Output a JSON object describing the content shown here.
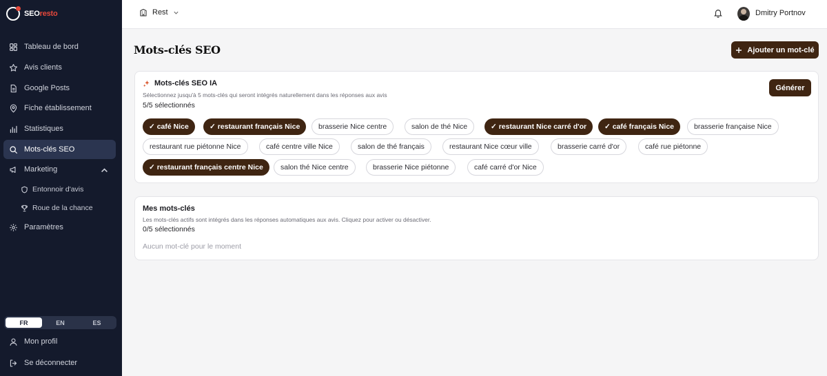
{
  "app": {
    "logo_main": "SEO",
    "logo_accent": "resto",
    "brand_color": "#3f2512",
    "logo_dot_color": "#e5483b"
  },
  "sidebar": {
    "items": [
      {
        "label": "Tableau de bord",
        "icon": "dashboard-icon"
      },
      {
        "label": "Avis clients",
        "icon": "star-icon"
      },
      {
        "label": "Google Posts",
        "icon": "document-icon"
      },
      {
        "label": "Fiche établissement",
        "icon": "map-pin-icon"
      },
      {
        "label": "Statistiques",
        "icon": "bar-chart-icon"
      },
      {
        "label": "Mots-clés SEO",
        "icon": "search-icon",
        "active": true
      },
      {
        "label": "Marketing",
        "icon": "megaphone-icon",
        "expanded": true
      }
    ],
    "sub_items": [
      {
        "label": "Entonnoir d'avis",
        "icon": "shield-icon"
      },
      {
        "label": "Roue de la chance",
        "icon": "trophy-icon"
      }
    ],
    "settings": {
      "label": "Paramètres",
      "icon": "gear-icon"
    },
    "languages": [
      "FR",
      "EN",
      "ES"
    ],
    "active_language": "FR",
    "profile": {
      "label": "Mon profil",
      "icon": "user-icon"
    },
    "logout": {
      "label": "Se déconnecter",
      "icon": "logout-icon"
    }
  },
  "header": {
    "restaurant": "Rest",
    "user_name": "Dmitry Portnov"
  },
  "page": {
    "title": "Mots-clés SEO",
    "add_button": "Ajouter un mot-clé"
  },
  "ai_card": {
    "title": "Mots-clés SEO IA",
    "description": "Sélectionnez jusqu'à 5 mots-clés qui seront intégrés naturellement dans les réponses aux avis",
    "count": "5/5 sélectionnés",
    "generate_button": "Générer",
    "keywords": [
      {
        "label": "café Nice",
        "selected": true
      },
      {
        "label": "restaurant français Nice",
        "selected": true
      },
      {
        "label": "brasserie Nice centre",
        "selected": false
      },
      {
        "label": "salon de thé Nice",
        "selected": false
      },
      {
        "label": "restaurant Nice carré d'or",
        "selected": true
      },
      {
        "label": "café français Nice",
        "selected": true
      },
      {
        "label": "brasserie française Nice",
        "selected": false
      },
      {
        "label": "restaurant rue piétonne Nice",
        "selected": false
      },
      {
        "label": "café centre ville Nice",
        "selected": false
      },
      {
        "label": "salon de thé français",
        "selected": false
      },
      {
        "label": "restaurant Nice cœur ville",
        "selected": false
      },
      {
        "label": "brasserie carré d'or",
        "selected": false
      },
      {
        "label": "café rue piétonne",
        "selected": false
      },
      {
        "label": "restaurant français centre Nice",
        "selected": true
      },
      {
        "label": "salon thé Nice centre",
        "selected": false
      },
      {
        "label": "brasserie Nice piétonne",
        "selected": false
      },
      {
        "label": "café carré d'or Nice",
        "selected": false
      }
    ]
  },
  "my_card": {
    "title": "Mes mots-clés",
    "description": "Les mots-clés actifs sont intégrés dans les réponses automatiques aux avis. Cliquez pour activer ou désactiver.",
    "count": "0/5 sélectionnés",
    "empty": "Aucun mot-clé pour le moment"
  }
}
